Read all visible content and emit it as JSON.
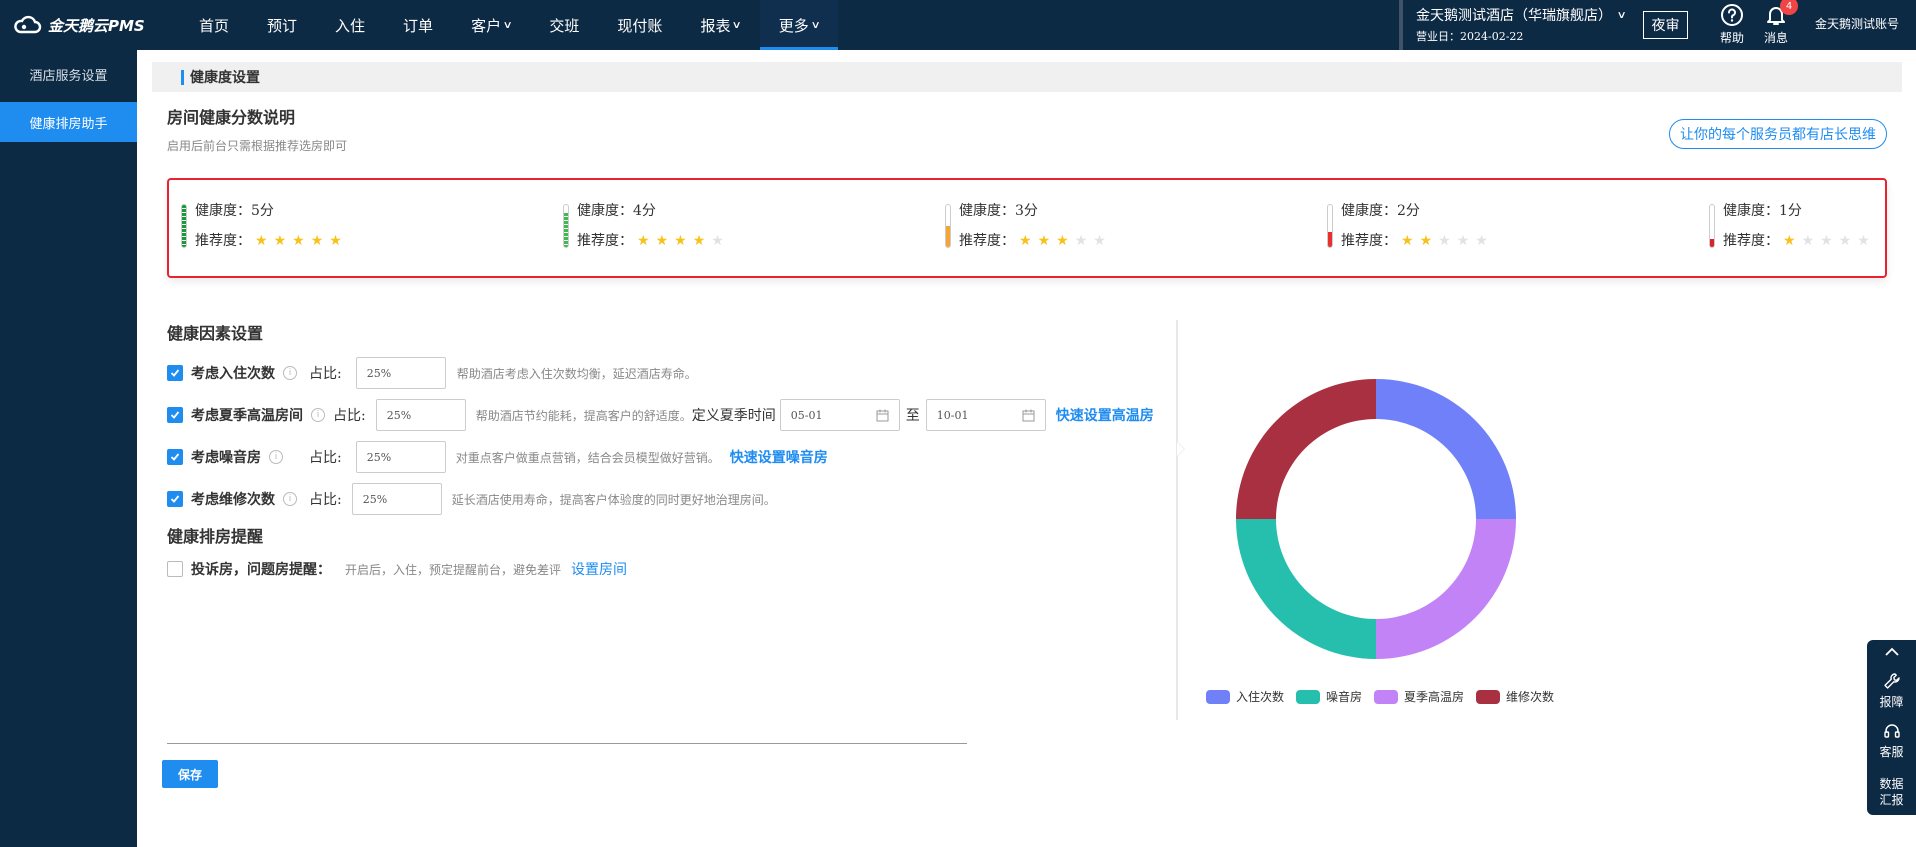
{
  "app": {
    "logo_text": "金天鹅云PMS"
  },
  "nav": {
    "items": [
      {
        "label": "首页",
        "caret": false
      },
      {
        "label": "预订",
        "caret": false
      },
      {
        "label": "入住",
        "caret": false
      },
      {
        "label": "订单",
        "caret": false
      },
      {
        "label": "客户",
        "caret": true
      },
      {
        "label": "交班",
        "caret": false
      },
      {
        "label": "现付账",
        "caret": false
      },
      {
        "label": "报表",
        "caret": true
      },
      {
        "label": "更多",
        "caret": true,
        "active": true
      }
    ]
  },
  "hotel": {
    "name": "金天鹅测试酒店（华瑞旗舰店）",
    "business_day": "营业日：2024-02-22"
  },
  "header": {
    "night_audit": "夜审",
    "help": "帮助",
    "messages": "消息",
    "message_count": "4",
    "account": "金天鹅测试账号"
  },
  "sidebar": {
    "items": [
      {
        "label": "酒店服务设置",
        "active": false
      },
      {
        "label": "健康排房助手",
        "active": true
      }
    ]
  },
  "page": {
    "section_title": "健康度设置",
    "score_title": "房间健康分数说明",
    "score_sub": "启用后前台只需根据推荐选房即可",
    "pill_button": "让你的每个服务员都有店长思维"
  },
  "scores": [
    {
      "health": "健康度：5分",
      "recommend": "推荐度：",
      "stars": 5,
      "color": "#1a9a3a",
      "fill": 1.0
    },
    {
      "health": "健康度：4分",
      "recommend": "推荐度：",
      "stars": 4,
      "color": "#3dbb4c",
      "fill": 0.8
    },
    {
      "health": "健康度：3分",
      "recommend": "推荐度：",
      "stars": 3,
      "color": "#f5a535",
      "fill": 0.5
    },
    {
      "health": "健康度：2分",
      "recommend": "推荐度：",
      "stars": 2,
      "color": "#e8312c",
      "fill": 0.35
    },
    {
      "health": "健康度：1分",
      "recommend": "推荐度：",
      "stars": 1,
      "color": "#d9232d",
      "fill": 0.2
    }
  ],
  "factors": {
    "title": "健康因素设置",
    "ratio_label": "占比:",
    "rows": [
      {
        "label": "考虑入住次数",
        "value": "25%",
        "hint": "帮助酒店考虑入住次数均衡，延迟酒店寿命。"
      },
      {
        "label": "考虑夏季高温房间",
        "value": "25%",
        "hint": "帮助酒店节约能耗，提高客户的舒适度。",
        "define_label": "定义夏季时间",
        "start": "05-01",
        "to": "至",
        "end": "10-01",
        "link": "快速设置高温房"
      },
      {
        "label": "考虑噪音房",
        "value": "25%",
        "hint": "对重点客户做重点营销，结合会员模型做好营销。",
        "link": "快速设置噪音房"
      },
      {
        "label": "考虑维修次数",
        "value": "25%",
        "hint": "延长酒店使用寿命，提高客户体验度的同时更好地治理房间。"
      }
    ]
  },
  "reminder": {
    "title": "健康排房提醒",
    "label": "投诉房，问题房提醒：",
    "hint": "开启后，入住，预定提醒前台，避免差评",
    "link": "设置房间"
  },
  "save": "保存",
  "chart_data": {
    "type": "pie",
    "donut": true,
    "categories": [
      "入住次数",
      "噪音房",
      "夏季高温房",
      "维修次数"
    ],
    "values": [
      25,
      25,
      25,
      25
    ],
    "colors": [
      "#7080f8",
      "#26bfae",
      "#c183f6",
      "#a83040"
    ],
    "slice_order": [
      "入住次数",
      "夏季高温房",
      "噪音房",
      "维修次数"
    ],
    "legend": "bottom"
  },
  "float_bar": {
    "report": "报障",
    "service": "客服",
    "data_line1": "数据",
    "data_line2": "汇报"
  }
}
